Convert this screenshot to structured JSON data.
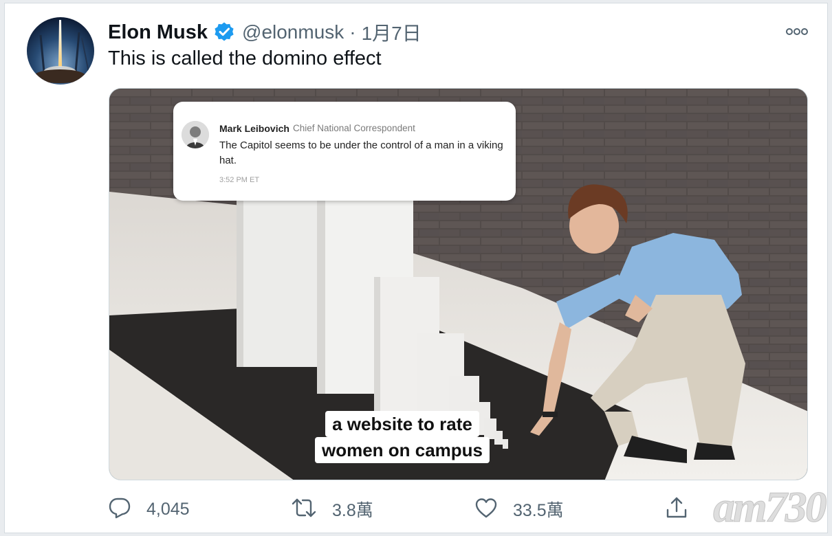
{
  "tweet": {
    "author_name": "Elon Musk",
    "handle": "@elonmusk",
    "separator": "·",
    "date": "1月7日",
    "text": "This is called the domino effect",
    "avatar_icon": "rocket-launch-avatar",
    "verified_icon": "verified-badge-icon",
    "more_icon": "more-options-icon"
  },
  "media": {
    "embedded_tweet": {
      "name": "Mark Leibovich",
      "title": "Chief National Correspondent",
      "body": "The Capitol seems to be under the control of a man in a viking hat.",
      "time": "3:52 PM ET"
    },
    "caption_line1": "a website to rate",
    "caption_line2": "women on campus"
  },
  "actions": {
    "reply_count": "4,045",
    "retweet_count": "3.8萬",
    "like_count": "33.5萬",
    "reply_icon": "reply-icon",
    "retweet_icon": "retweet-icon",
    "like_icon": "heart-icon",
    "share_icon": "share-icon"
  },
  "watermark": {
    "text": "am730"
  },
  "colors": {
    "verified_blue": "#1d9bf0",
    "secondary_text": "#536471",
    "primary_text": "#0f1419"
  }
}
